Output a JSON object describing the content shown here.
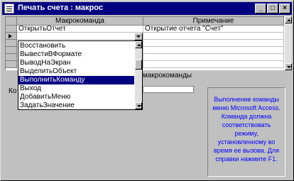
{
  "window": {
    "title": "Печать счета : макрос",
    "controls": [
      "_",
      "□",
      "×"
    ]
  },
  "grid": {
    "columns": [
      "Макрокоманда",
      "Примечание"
    ],
    "rows": [
      {
        "action": "ОткрытьОтчет",
        "note": "Открытие отчета \"Счет\""
      },
      {
        "action": "",
        "note": ""
      },
      {
        "action": "",
        "note": ""
      },
      {
        "action": "",
        "note": ""
      },
      {
        "action": "",
        "note": ""
      },
      {
        "action": "",
        "note": ""
      }
    ]
  },
  "dropdown": {
    "items": [
      "Восстановить",
      "ВывестиВФормате",
      "ВыводНаЭкран",
      "ВыделитьОбъект",
      "ВыполнитьКоманду",
      "Выход",
      "ДобавитьМеню",
      "ЗадатьЗначение"
    ],
    "selected": "ВыполнитьКоманду"
  },
  "section_label": "макрокоманды",
  "field_label": "Ко",
  "help_text": "Выполнение команды меню Microsoft Access. Команда должна соответствовать режиму, установленному во время ее вызова. Для справки нажмите F1.",
  "colors": {
    "titlebar": "#000080",
    "selection": "#000080",
    "help_text": "#0000ff"
  }
}
